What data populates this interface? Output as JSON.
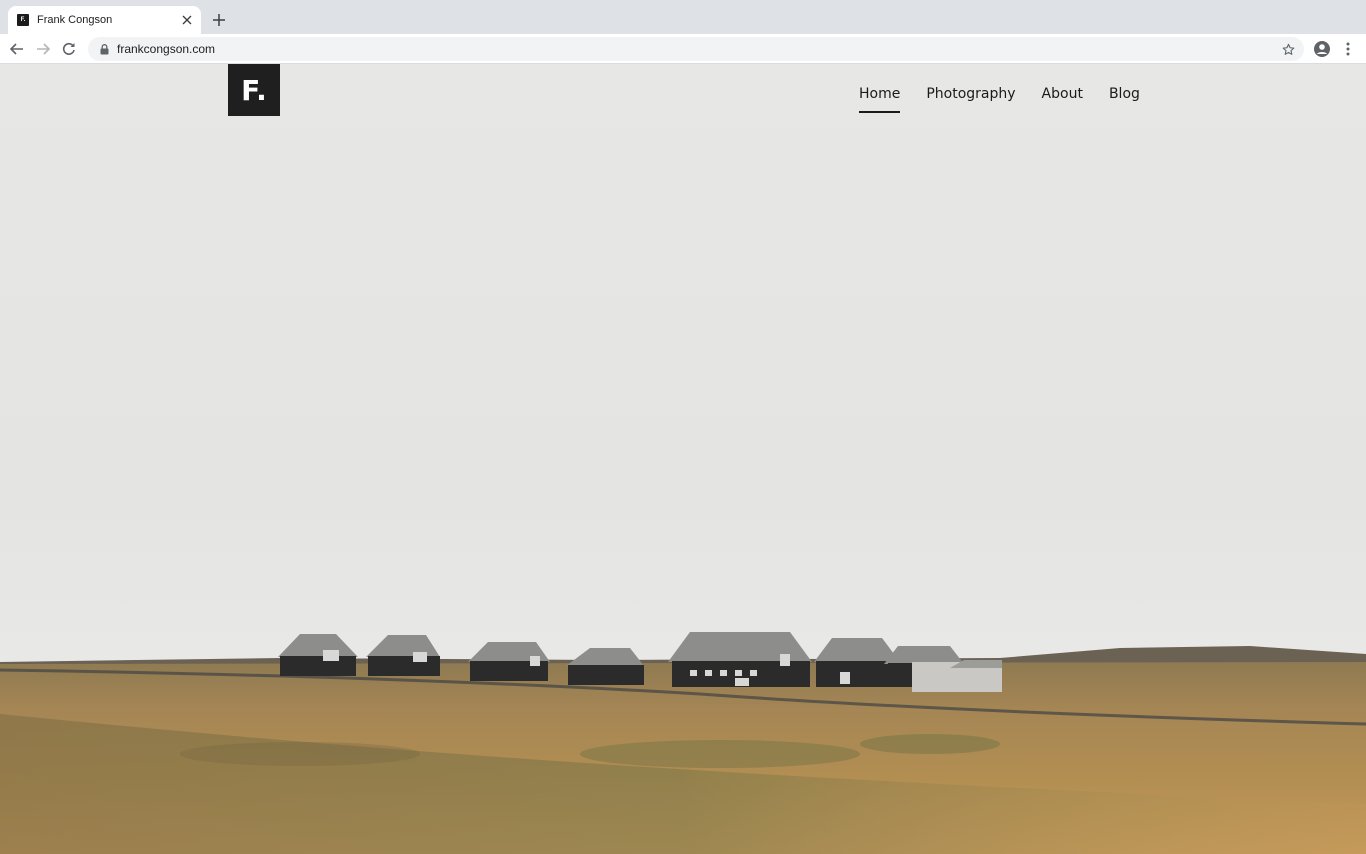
{
  "browser": {
    "tab": {
      "favicon_text": "F.",
      "title": "Frank Congson"
    },
    "address_bar": {
      "url": "frankcongson.com"
    },
    "icons": {
      "back": "back-arrow-icon",
      "forward": "forward-arrow-icon",
      "reload": "reload-icon",
      "lock": "lock-icon",
      "bookmark": "star-icon",
      "profile": "account-icon",
      "menu": "kebab-menu-icon",
      "new_tab": "plus-icon",
      "close_tab": "close-icon"
    }
  },
  "site": {
    "logo_text": "F.",
    "nav": [
      {
        "label": "Home",
        "active": true
      },
      {
        "label": "Photography",
        "active": false
      },
      {
        "label": "About",
        "active": false
      },
      {
        "label": "Blog",
        "active": false
      }
    ],
    "hero": {
      "description_only_visual": true,
      "sky_color": "#e6e6e4",
      "grass_color": "#b8914f",
      "house_color": "#2b2b2b",
      "roof_color": "#8d8d8b"
    }
  }
}
